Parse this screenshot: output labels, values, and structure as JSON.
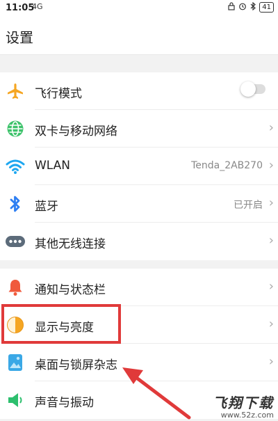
{
  "status": {
    "time": "11:05",
    "signal": "4G",
    "battery": "41"
  },
  "header": {
    "title": "设置"
  },
  "groups": [
    {
      "items": [
        {
          "label": "飞行模式",
          "icon": "airplane-icon",
          "control": "toggle",
          "toggle_on": false
        },
        {
          "label": "双卡与移动网络",
          "icon": "globe-icon"
        },
        {
          "label": "WLAN",
          "icon": "wifi-icon",
          "value": "Tenda_2AB270"
        },
        {
          "label": "蓝牙",
          "icon": "bluetooth-icon",
          "value": "已开启"
        },
        {
          "label": "其他无线连接",
          "icon": "more-dots-icon"
        }
      ]
    },
    {
      "items": [
        {
          "label": "通知与状态栏",
          "icon": "bell-icon"
        },
        {
          "label": "显示与亮度",
          "icon": "brightness-icon"
        },
        {
          "label": "桌面与锁屏杂志",
          "icon": "wallpaper-icon"
        },
        {
          "label": "声音与振动",
          "icon": "speaker-icon"
        }
      ]
    }
  ],
  "chevron": "›",
  "colors": {
    "highlight": "#e03a3a",
    "airplane": "#f5a623",
    "globe": "#3cc26a",
    "wifi": "#1ea7f0",
    "bluetooth": "#2f7ff2",
    "bell": "#f05a3c",
    "brightness": "#f5a623",
    "wallpaper": "#3aa8e6",
    "speaker": "#2dbf6e"
  },
  "watermark": {
    "big": "飞翔下载",
    "small": "www.52z.com"
  }
}
